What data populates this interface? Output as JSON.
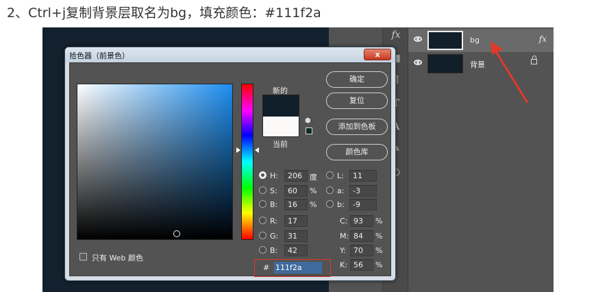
{
  "caption": "2、Ctrl+j复制背景层取名为bg，填充颜色：#111f2a",
  "layers": [
    {
      "name": "bg",
      "selected": true,
      "badge": "fx"
    },
    {
      "name": "背景",
      "selected": false,
      "locked": true
    }
  ],
  "tool_strip": {
    "fx_glyph": "fx"
  },
  "dialog": {
    "title": "拾色器（前景色）",
    "close_glyph": "x",
    "new_label": "新的",
    "current_label": "当前",
    "buttons": {
      "ok": "确定",
      "reset": "复位",
      "add_swatch": "添加到色板",
      "libraries": "颜色库"
    },
    "hsb": {
      "h_label": "H:",
      "h_value": "206",
      "h_unit": "度",
      "s_label": "S:",
      "s_value": "60",
      "s_unit": "%",
      "b_label": "B:",
      "b_value": "16",
      "b_unit": "%"
    },
    "lab": {
      "l_label": "L:",
      "l_value": "11",
      "a_label": "a:",
      "a_value": "-3",
      "b_label": "b:",
      "b_value": "-9"
    },
    "rgb": {
      "r_label": "R:",
      "r_value": "17",
      "g_label": "G:",
      "g_value": "31",
      "b_label": "B:",
      "b_value": "42"
    },
    "cmyk": {
      "c_label": "C:",
      "c_value": "93",
      "m_label": "M:",
      "m_value": "84",
      "y_label": "Y:",
      "y_value": "70",
      "k_label": "K:",
      "k_value": "56",
      "unit": "%"
    },
    "hex_label": "#",
    "hex_value": "111f2a",
    "web_only_label": "只有 Web 颜色"
  },
  "colors": {
    "fill": "#111f2a",
    "highlight_box": "#e0392a",
    "arrow": "#e0392a"
  }
}
